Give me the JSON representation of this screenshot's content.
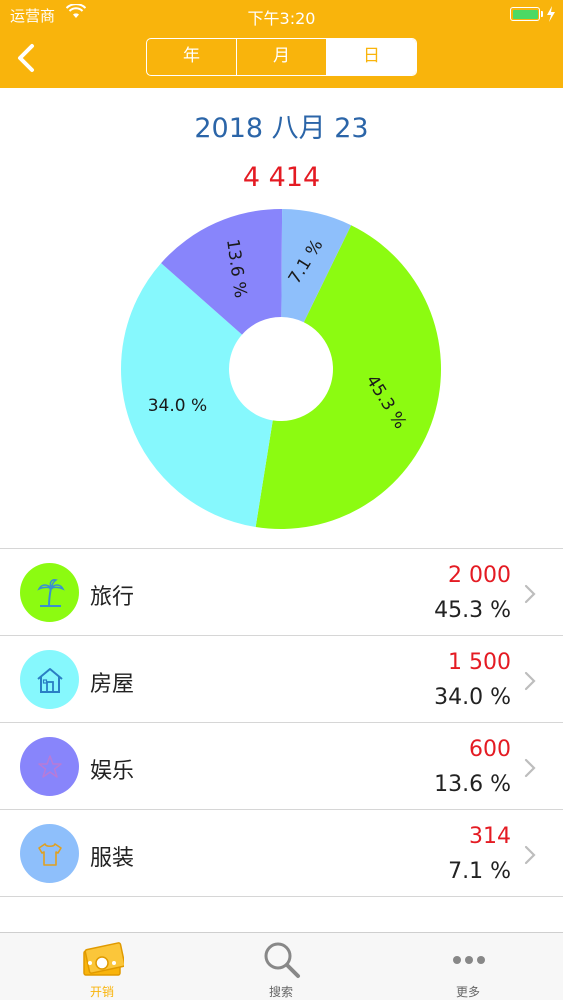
{
  "status_bar": {
    "carrier": "运营商",
    "time": "下午3:20"
  },
  "nav": {
    "segments": [
      "年",
      "月",
      "日"
    ],
    "active_segment": 2
  },
  "summary": {
    "date": "2018 八月 23",
    "total": "4 414"
  },
  "colors": {
    "accent": "#f9b40c",
    "travel": "#8cfb11",
    "house": "#86f8fd",
    "fun": "#8885fb",
    "clothes": "#8ebffb",
    "amount": "#e41b23",
    "date": "#2b65a8"
  },
  "chart_data": {
    "type": "pie",
    "donut": true,
    "categories": [
      "旅行",
      "房屋",
      "娱乐",
      "服装"
    ],
    "values": [
      2000,
      1500,
      600,
      314
    ],
    "slice_labels": [
      "45.3 %",
      "34.0 %",
      "13.6 %",
      "7.1 %"
    ],
    "colors": [
      "#8cfb11",
      "#86f8fd",
      "#8885fb",
      "#8ebffb"
    ]
  },
  "list": [
    {
      "name": "旅行",
      "amount": "2 000",
      "percent": "45.3 %",
      "icon": "palm-tree-icon"
    },
    {
      "name": "房屋",
      "amount": "1 500",
      "percent": "34.0 %",
      "icon": "house-icon"
    },
    {
      "name": "娱乐",
      "amount": "600",
      "percent": "13.6 %",
      "icon": "star-icon"
    },
    {
      "name": "服装",
      "amount": "314",
      "percent": "7.1 %",
      "icon": "shirt-icon"
    }
  ],
  "tabs": [
    {
      "label": "开销",
      "icon": "money-icon"
    },
    {
      "label": "搜索",
      "icon": "search-icon"
    },
    {
      "label": "更多",
      "icon": "more-icon"
    }
  ]
}
